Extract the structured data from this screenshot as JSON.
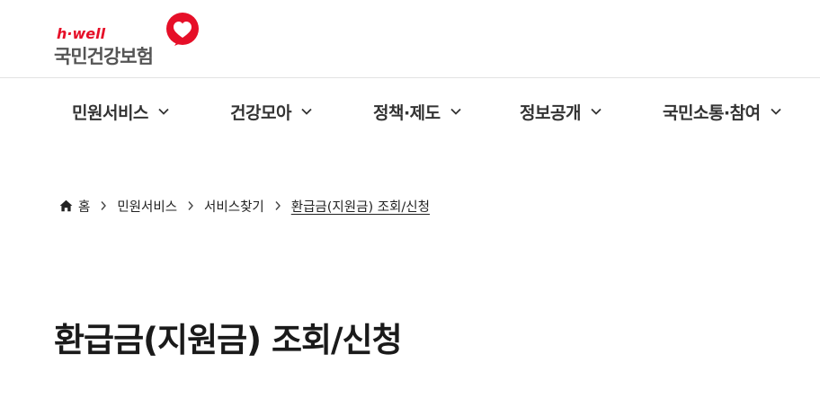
{
  "header": {
    "logo_sub": "h·well",
    "logo_main": "국민건강보험",
    "brand_color": "#e60f28"
  },
  "gnb": {
    "items": [
      {
        "label": "민원서비스",
        "icon": "chevron-down-icon"
      },
      {
        "label": "건강모아",
        "icon": "chevron-down-icon"
      },
      {
        "label": "정책·제도",
        "icon": "chevron-down-icon"
      },
      {
        "label": "정보공개",
        "icon": "chevron-down-icon"
      },
      {
        "label": "국민소통·참여",
        "icon": "chevron-down-icon"
      }
    ]
  },
  "breadcrumb": {
    "home_label": "홈",
    "items": [
      "민원서비스",
      "서비스찾기",
      "환급금(지원금) 조회/신청"
    ]
  },
  "page": {
    "title": "환급금(지원금) 조회/신청"
  }
}
